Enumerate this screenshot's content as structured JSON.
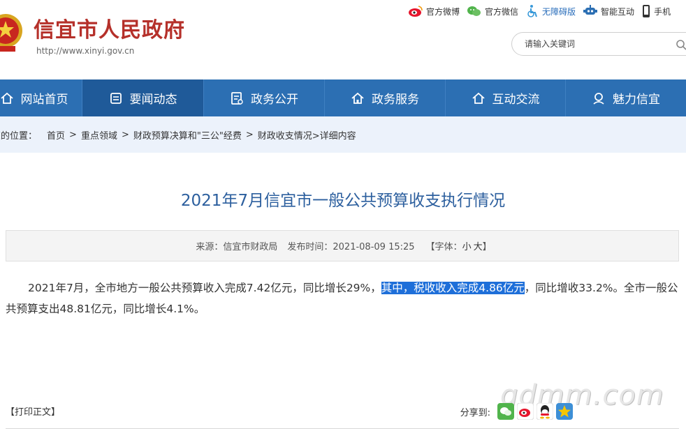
{
  "header": {
    "site_title": "信宜市人民政府",
    "site_url": "http://www.xinyi.gov.cn",
    "top_links": [
      {
        "label": "官方微博",
        "icon": "weibo-icon",
        "color": "#333333"
      },
      {
        "label": "官方微信",
        "icon": "wechat-icon",
        "color": "#333333"
      },
      {
        "label": "无障碍版",
        "icon": "accessibility-icon",
        "color": "#2a6ebb"
      },
      {
        "label": "智能互动",
        "icon": "robot-icon",
        "color": "#333333"
      },
      {
        "label": "手机",
        "icon": "mobile-icon",
        "color": "#333333"
      }
    ],
    "search_placeholder": "请输入关键词"
  },
  "nav": {
    "items": [
      {
        "label": "网站首页",
        "icon": "home-icon",
        "active": false
      },
      {
        "label": "要闻动态",
        "icon": "news-icon",
        "active": true
      },
      {
        "label": "政务公开",
        "icon": "document-icon",
        "active": false
      },
      {
        "label": "政务服务",
        "icon": "home-icon",
        "active": false
      },
      {
        "label": "互动交流",
        "icon": "home-icon",
        "active": false
      },
      {
        "label": "魅力信宜",
        "icon": "location-icon",
        "active": false
      }
    ]
  },
  "breadcrumb": {
    "prefix": "您的位置：",
    "items": [
      "首页",
      "重点领域",
      "财政预算决算和\"三公\"经费",
      "财政收支情况"
    ],
    "tail": ">详细内容"
  },
  "article": {
    "title": "2021年7月信宜市一般公共预算收支执行情况",
    "source_label": "来源：信宜市财政局",
    "publish_label": "发布时间：2021-08-09 15:25",
    "font_label_open": "【字体：",
    "font_small": "小",
    "font_large": "大",
    "font_label_close": "】",
    "body_before": "2021年7月，全市地方一般公共预算收入完成7.42亿元，同比增长29%，",
    "body_highlight": "其中，税收收入完成4.86亿元",
    "body_after": "，同比增收33.2%。全市一般公共预算支出48.81亿元，同比增长4.1%。"
  },
  "footer": {
    "print_label": "【打印正文】",
    "share_label": "分享到:",
    "share_icons": [
      "wechat-share-icon",
      "weibo-share-icon",
      "qq-share-icon",
      "qzone-share-icon"
    ]
  },
  "watermark": "gdmm.com",
  "colors": {
    "brand_red": "#b5302a",
    "nav_blue": "#2c6fb3",
    "nav_active": "#1f5a99",
    "title_blue": "#2c5f9e",
    "highlight": "#1e6fd9"
  }
}
